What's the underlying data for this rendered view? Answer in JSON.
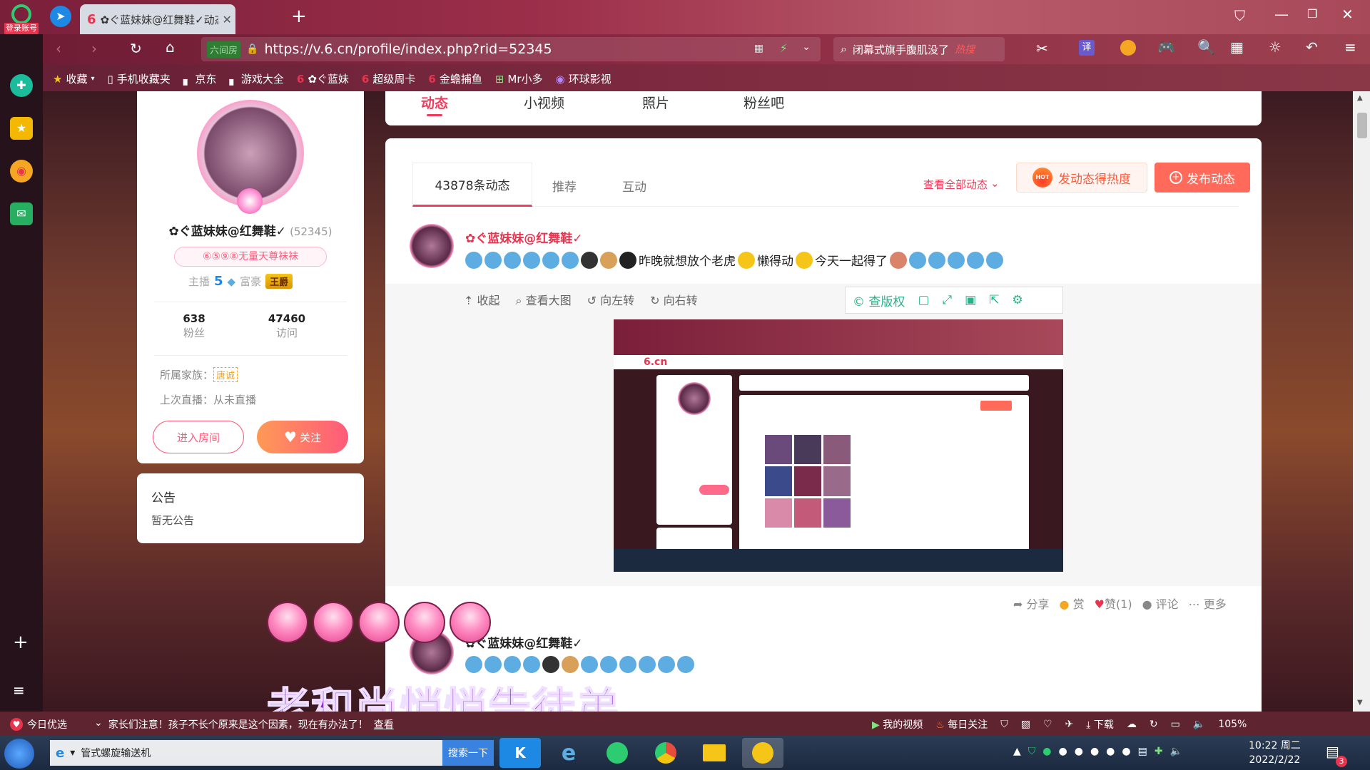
{
  "browser": {
    "login_badge": "登录账号",
    "tab_title": "✿ぐ蓝妹妹@红舞鞋✓动态 - 在",
    "new_tab": "+",
    "url": "https://v.6.cn/profile/index.php?rid=52345",
    "site_chip": "六间房",
    "search_text": "闭幕式旗手腹肌没了",
    "search_hot": "热搜",
    "translate": "译",
    "bookmarks": [
      "收藏",
      "手机收藏夹",
      "京东",
      "游戏大全",
      "✿ぐ蓝妹",
      "超级周卡",
      "金蟾捕鱼",
      "Mr小多",
      "环球影视"
    ]
  },
  "profile": {
    "name": "✿ぐ蓝妹妹@红舞鞋✓",
    "rid": "(52345)",
    "badge": "⑥⑤⑨⑧无量天尊袜袜",
    "host_label": "主播",
    "host_level": "5",
    "rich_label": "富豪",
    "rich_badge": "王爵",
    "fans_count": "638",
    "fans_label": "粉丝",
    "visits_count": "47460",
    "visits_label": "访问",
    "family_label": "所属家族：",
    "family_value": "唐诚",
    "last_live": "上次直播：从未直播",
    "enter_room": "进入房间",
    "follow": "关注"
  },
  "notice": {
    "title": "公告",
    "content": "暂无公告"
  },
  "nav_tabs": [
    "动态",
    "小视频",
    "照片",
    "粉丝吧"
  ],
  "feed": {
    "tabs": [
      "43878条动态",
      "推荐",
      "互动"
    ],
    "view_all": "查看全部动态",
    "hot_button": "发动态得热度",
    "hot_tag": "HOT",
    "publish": "发布动态",
    "post1_name": "✿ぐ蓝妹妹@红舞鞋✓",
    "post1_text_a": "昨晚就想放个老虎",
    "post1_text_b": "懒得动",
    "post1_text_c": "今天一起得了",
    "img_tools": [
      "收起",
      "查看大图",
      "向左转",
      "向右转"
    ],
    "cha_quan": "查版权",
    "actions": [
      "分享",
      "赏",
      "赞(1)",
      "评论",
      "更多"
    ],
    "post2_name": "✿ぐ蓝妹妹@红舞鞋✓"
  },
  "overlay": {
    "caption": "老和尚悄悄告徒弟"
  },
  "status": {
    "today": "今日优选",
    "ticker": "家长们注意！孩子不长个原来是这个因素，现在有办法了！",
    "ticker_link": "查看",
    "my_video": "我的视频",
    "daily": "每日关注",
    "download": "下载",
    "zoom": "105%"
  },
  "taskbar": {
    "app_title": "管式螺旋输送机",
    "search_btn": "搜索一下",
    "time": "10:22 周二",
    "date": "2022/2/22",
    "notif": "3"
  },
  "colors": {
    "accent": "#ff4e6a",
    "tab_underline": "#f23c5d",
    "gold": "#f5a623"
  }
}
